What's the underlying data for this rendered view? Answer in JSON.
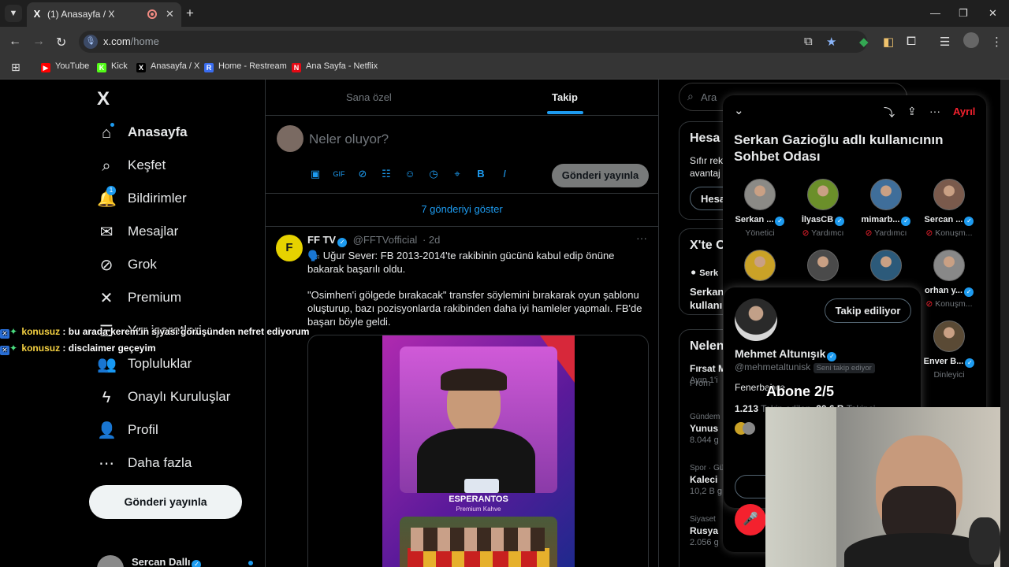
{
  "browser": {
    "tab_title": "(1) Anasayfa / X",
    "url_host": "x.com",
    "url_path": "/home",
    "bookmarks": [
      {
        "label": "YouTube",
        "color": "#ff0000",
        "glyph": "▶"
      },
      {
        "label": "Kick",
        "color": "#53fc18",
        "glyph": "K"
      },
      {
        "label": "Anasayfa / X",
        "color": "#000000",
        "glyph": "X"
      },
      {
        "label": "Home - Restream",
        "color": "#3a6df0",
        "glyph": "R"
      },
      {
        "label": "Ana Sayfa - Netflix",
        "color": "#e50914",
        "glyph": "N"
      }
    ]
  },
  "nav": {
    "logo": "X",
    "items": [
      {
        "key": "home",
        "label": "Anasayfa",
        "icon": "home-icon"
      },
      {
        "key": "explore",
        "label": "Keşfet",
        "icon": "search-icon"
      },
      {
        "key": "notifications",
        "label": "Bildirimler",
        "icon": "bell-icon",
        "badge": "1"
      },
      {
        "key": "messages",
        "label": "Mesajlar",
        "icon": "mail-icon"
      },
      {
        "key": "grok",
        "label": "Grok",
        "icon": "grok-icon"
      },
      {
        "key": "premium",
        "label": "Premium",
        "icon": "x-premium-icon"
      },
      {
        "key": "lists",
        "label": "Yer işaretleri",
        "icon": "bookmark-icon"
      },
      {
        "key": "communities",
        "label": "Topluluklar",
        "icon": "people-icon"
      },
      {
        "key": "verified_orgs",
        "label": "Onaylı Kuruluşlar",
        "icon": "lightning-icon"
      },
      {
        "key": "profile",
        "label": "Profil",
        "icon": "person-icon"
      },
      {
        "key": "more",
        "label": "Daha fazla",
        "icon": "more-circle-icon"
      }
    ],
    "post_button": "Gönderi yayınla",
    "account_name": "Sercan Dallı"
  },
  "main": {
    "tabs": [
      {
        "label": "Sana özel"
      },
      {
        "label": "Takip"
      }
    ],
    "compose_placeholder": "Neler oluyor?",
    "compose_button": "Gönderi yayınla",
    "show_more": "7 gönderiyi göster",
    "tweet": {
      "author": "FF TV",
      "handle": "@FFTVofficial",
      "time": "· 2d",
      "line1": "🗣️ Uğur Sever: FB 2013-2014'te rakibinin gücünü kabul edip önüne bakarak başarılı oldu.",
      "line2": "\"Osimhen'i gölgede bırakacak\" transfer söylemini bırakarak oyun şablonu oluşturup, bazı pozisyonlarda rakibinden daha iyi hamleler yapmalı. FB'de başarı böyle geldi.",
      "image_caption": "ESPERANTOS",
      "image_subcaption": "Premium Kahve"
    }
  },
  "right": {
    "search_placeholder": "Ara",
    "box1_title": "Hesa",
    "box1_text1": "Sıfır rek",
    "box1_text2": "avantaj",
    "box1_button": "Hesa",
    "box2_title": "X'te C",
    "box2_line1": "Serk",
    "box2_line2": "Serkan",
    "box2_line3": "kullanı",
    "box3_title": "Nelen",
    "trends": [
      {
        "meta": "",
        "title": "Fırsat M",
        "sub": "Ayın 1'i"
      },
      {
        "meta": "",
        "title": "",
        "sub": "Prom"
      },
      {
        "meta": "Gündem",
        "title": "Yunus",
        "sub": "8.044 g"
      },
      {
        "meta": "Spor · Gü",
        "title": "Kaleci",
        "sub": "10,2 B g"
      },
      {
        "meta": "Siyaset",
        "title": "Rusya",
        "sub": "2.056 g"
      }
    ]
  },
  "spaces": {
    "leave": "Ayrıl",
    "title": "Serkan Gazioğlu adlı kullanıcının Sohbet Odası",
    "users": [
      {
        "name": "Serkan ...",
        "role": "Yönetici",
        "color": "#8b8a86",
        "mic": false
      },
      {
        "name": "İlyasCB",
        "role": "Yardımcı",
        "color": "#6b8f2a",
        "mic": true
      },
      {
        "name": "mimarb...",
        "role": "Yardımcı",
        "color": "#3f6e9a",
        "mic": true
      },
      {
        "name": "Sercan ...",
        "role": "Konuşm...",
        "color": "#7a5a4c",
        "mic": true
      },
      {
        "name": "",
        "role": "",
        "color": "#caa227",
        "mic": false
      },
      {
        "name": "",
        "role": "",
        "color": "#4a4a4a",
        "mic": false
      },
      {
        "name": "",
        "role": "",
        "color": "#2c5a7a",
        "mic": false
      },
      {
        "name": "orhan y...",
        "role": "Konuşm...",
        "color": "#888888",
        "mic": true
      },
      {
        "name": "Enver B...",
        "role": "Dinleyici",
        "color": "#5a4a35",
        "mic": false
      }
    ]
  },
  "hovercard": {
    "follow_button": "Takip ediliyor",
    "name": "Mehmet Altunışık",
    "handle": "@mehmetaltunisk",
    "follows_you": "Seni takip ediyor",
    "bio": "Fenerbahçe",
    "following_count": "1.213",
    "following_label": "Takip edilen",
    "followers_count": "20,6 B",
    "followers_label": "Takipçi"
  },
  "overlay": {
    "sub_goal": "Abone 2/5",
    "chat": [
      {
        "user": "konusuz",
        "text": ": bu arada kerem'in siyasi görüşünden nefret ediyorum"
      },
      {
        "user": "konusuz",
        "text": ": disclaimer geçeyim"
      }
    ]
  }
}
